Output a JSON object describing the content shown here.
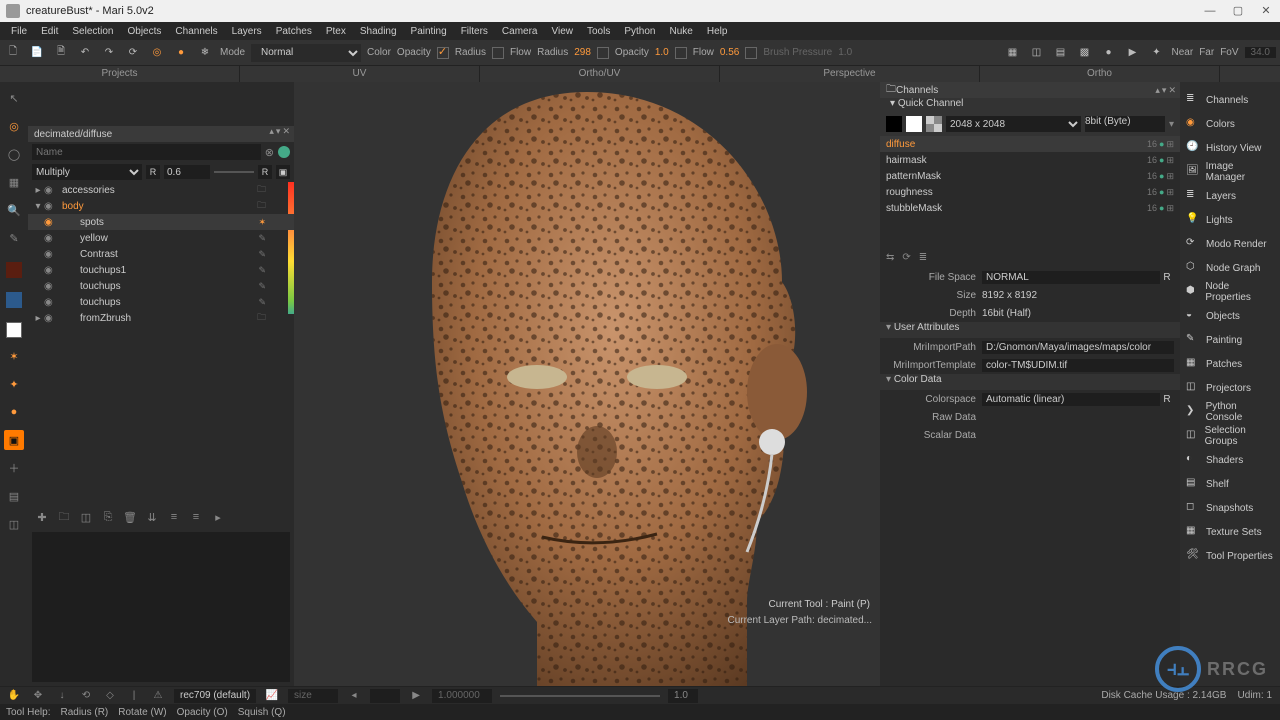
{
  "titlebar": {
    "title": "creatureBust* - Mari 5.0v2"
  },
  "menu": [
    "File",
    "Edit",
    "Selection",
    "Objects",
    "Channels",
    "Layers",
    "Patches",
    "Ptex",
    "Shading",
    "Painting",
    "Filters",
    "Camera",
    "View",
    "Tools",
    "Python",
    "Nuke",
    "Help"
  ],
  "toolbar": {
    "mode_label": "Mode",
    "mode_value": "Normal",
    "color_label": "Color",
    "opacity_label": "Opacity",
    "radius_label": "Radius",
    "flow_label": "Flow",
    "radius2_label": "Radius",
    "radius2_value": "298",
    "opacity2_label": "Opacity",
    "opacity2_value": "1.0",
    "flow2_label": "Flow",
    "flow2_value": "0.56",
    "brush_pressure_label": "Brush Pressure",
    "brush_pressure_value": "1.0",
    "near": "Near",
    "far": "Far",
    "fov": "FoV"
  },
  "view_tabs": [
    "Projects",
    "UV",
    "Ortho/UV",
    "Perspective",
    "Ortho"
  ],
  "layers": {
    "panel_title": "decimated/diffuse",
    "name_placeholder": "Name",
    "blend_mode": "Multiply",
    "opacity_R": "R",
    "opacity_value": "0.6",
    "items": [
      {
        "label": "accessories",
        "type": "group",
        "expanded": false,
        "indent": 0
      },
      {
        "label": "body",
        "type": "group",
        "expanded": true,
        "indent": 0,
        "hl": true
      },
      {
        "label": "spots",
        "type": "layer",
        "indent": 1,
        "selected": true
      },
      {
        "label": "yellow",
        "type": "layer",
        "indent": 1
      },
      {
        "label": "Contrast",
        "type": "layer",
        "indent": 1
      },
      {
        "label": "touchups1",
        "type": "layer",
        "indent": 1
      },
      {
        "label": "touchups",
        "type": "layer",
        "indent": 1
      },
      {
        "label": "touchups",
        "type": "layer",
        "indent": 1
      },
      {
        "label": "fromZbrush",
        "type": "group",
        "expanded": false,
        "indent": 1
      }
    ]
  },
  "channels": {
    "panel_title": "Channels",
    "quick_channel": "Quick Channel",
    "resolution": "2048 x 2048",
    "depth_label": "8bit  (Byte)",
    "list": [
      "diffuse",
      "hairmask",
      "patternMask",
      "roughness",
      "stubbleMask"
    ],
    "info": {
      "file_space_k": "File Space",
      "file_space_v": "NORMAL",
      "size_k": "Size",
      "size_v": "8192 x 8192",
      "depth_k": "Depth",
      "depth_v": "16bit (Half)"
    },
    "user_attr_h": "User Attributes",
    "mri_path_k": "MriImportPath",
    "mri_path_v": "D:/Gnomon/Maya/images/maps/color",
    "mri_tmpl_k": "MriImportTemplate",
    "mri_tmpl_v": "color-TM$UDIM.tif",
    "color_data_h": "Color Data",
    "colorspace_k": "Colorspace",
    "colorspace_v": "Automatic (linear)",
    "raw_k": "Raw Data",
    "scalar_k": "Scalar Data"
  },
  "shelf": [
    "Channels",
    "Colors",
    "History View",
    "Image Manager",
    "Layers",
    "Lights",
    "Modo Render",
    "Node Graph",
    "Node Properties",
    "Objects",
    "Painting",
    "Patches",
    "Projectors",
    "Python Console",
    "Selection Groups",
    "Shaders",
    "Shelf",
    "Snapshots",
    "Texture Sets",
    "Tool Properties"
  ],
  "bottombar": {
    "colorspace": "rec709 (default)",
    "clp_layer_label": "Current Layer Path: decimated...",
    "disk_cache": "Disk Cache Usage : 2.14GB",
    "udim": "Udim: 1"
  },
  "hintbar": [
    "Tool Help:",
    "Radius (R)",
    "Rotate (W)",
    "Opacity (O)",
    "Squish (Q)"
  ],
  "cur_tool": {
    "l1": "Current Tool : Paint (P)",
    "l2": ""
  },
  "watermark": "RRCG"
}
